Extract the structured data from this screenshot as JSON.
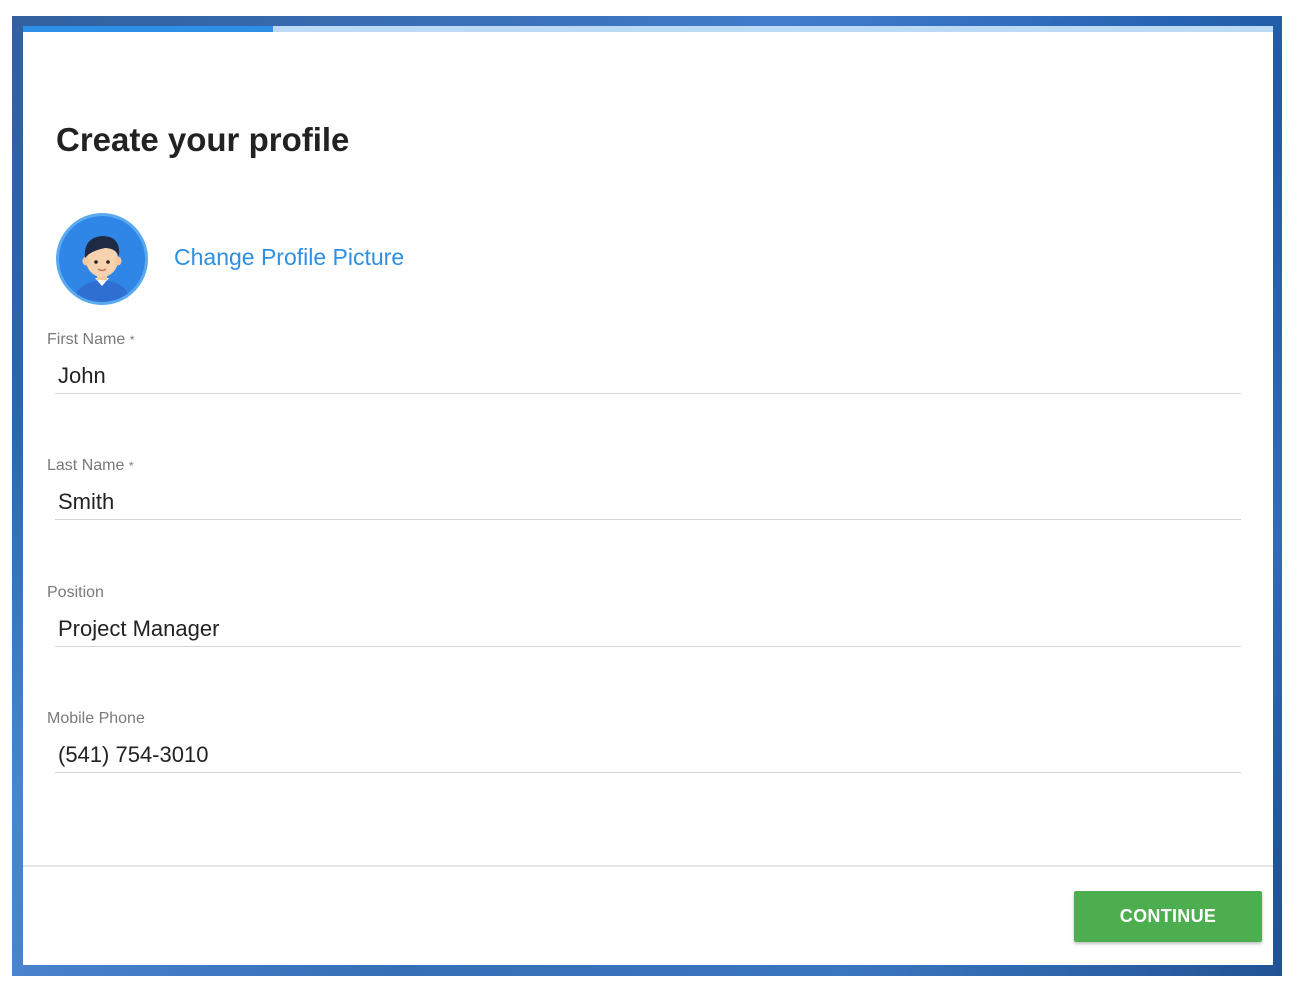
{
  "progress": {
    "fraction": 0.2,
    "fill_color": "#2f8ee6",
    "track_color": "#bcdaf5"
  },
  "header": {
    "title": "Create your profile"
  },
  "avatar": {
    "icon": "user-avatar-icon",
    "change_label": "Change Profile Picture",
    "link_color": "#2e8fe5"
  },
  "form": {
    "fields": [
      {
        "label": "First Name",
        "required_mark": "*",
        "value": "John"
      },
      {
        "label": "Last Name",
        "required_mark": "*",
        "value": "Smith"
      },
      {
        "label": "Position",
        "required_mark": "",
        "value": "Project Manager"
      },
      {
        "label": "Mobile Phone",
        "required_mark": "",
        "value": "(541) 754-3010"
      }
    ]
  },
  "footer": {
    "continue_label": "CONTINUE",
    "continue_color": "#4cae4f"
  }
}
